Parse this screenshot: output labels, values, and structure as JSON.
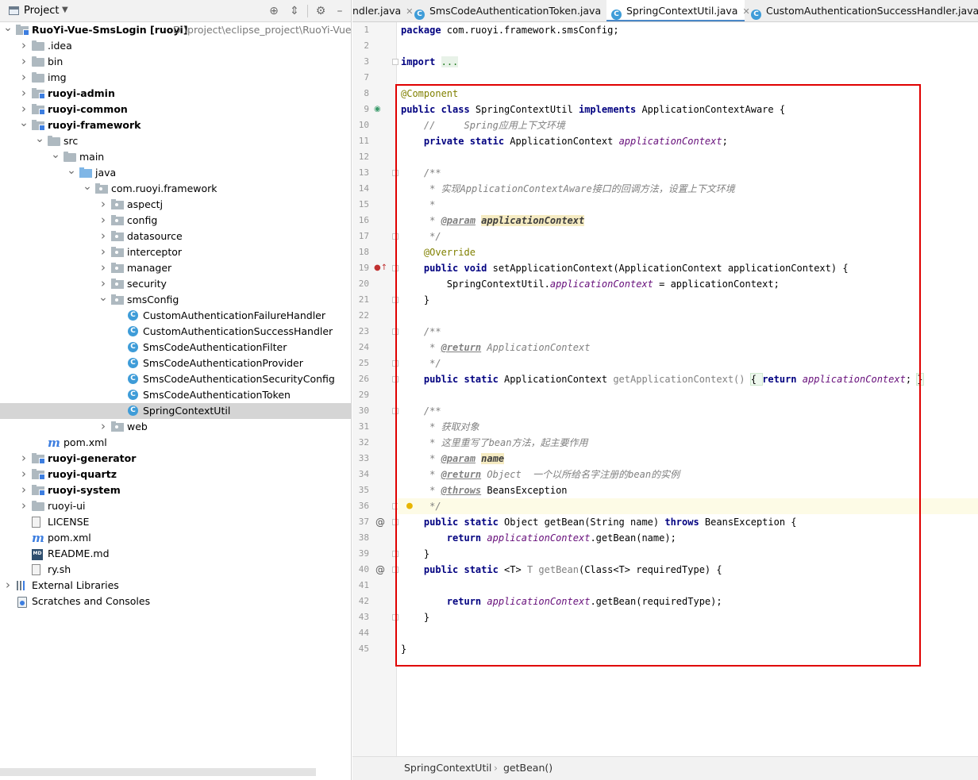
{
  "project": {
    "title": "Project",
    "tree": [
      {
        "label": "RuoYi-Vue-SmsLogin [ruoyi]",
        "path": "D:\\project\\eclipse_project\\RuoYi-Vue-Sms",
        "depth": 0,
        "arrow": "open",
        "icon": "module",
        "bold": true
      },
      {
        "label": ".idea",
        "depth": 1,
        "arrow": "closed",
        "icon": "folder"
      },
      {
        "label": "bin",
        "depth": 1,
        "arrow": "closed",
        "icon": "folder"
      },
      {
        "label": "img",
        "depth": 1,
        "arrow": "closed",
        "icon": "folder"
      },
      {
        "label": "ruoyi-admin",
        "depth": 1,
        "arrow": "closed",
        "icon": "module",
        "bold": true
      },
      {
        "label": "ruoyi-common",
        "depth": 1,
        "arrow": "closed",
        "icon": "module",
        "bold": true
      },
      {
        "label": "ruoyi-framework",
        "depth": 1,
        "arrow": "open",
        "icon": "module",
        "bold": true
      },
      {
        "label": "src",
        "depth": 2,
        "arrow": "open",
        "icon": "folder"
      },
      {
        "label": "main",
        "depth": 3,
        "arrow": "open",
        "icon": "folder"
      },
      {
        "label": "java",
        "depth": 4,
        "arrow": "open",
        "icon": "src"
      },
      {
        "label": "com.ruoyi.framework",
        "depth": 5,
        "arrow": "open",
        "icon": "pkg"
      },
      {
        "label": "aspectj",
        "depth": 6,
        "arrow": "closed",
        "icon": "pkg"
      },
      {
        "label": "config",
        "depth": 6,
        "arrow": "closed",
        "icon": "pkg"
      },
      {
        "label": "datasource",
        "depth": 6,
        "arrow": "closed",
        "icon": "pkg"
      },
      {
        "label": "interceptor",
        "depth": 6,
        "arrow": "closed",
        "icon": "pkg"
      },
      {
        "label": "manager",
        "depth": 6,
        "arrow": "closed",
        "icon": "pkg"
      },
      {
        "label": "security",
        "depth": 6,
        "arrow": "closed",
        "icon": "pkg"
      },
      {
        "label": "smsConfig",
        "depth": 6,
        "arrow": "open",
        "icon": "pkg"
      },
      {
        "label": "CustomAuthenticationFailureHandler",
        "depth": 7,
        "arrow": "none",
        "icon": "class"
      },
      {
        "label": "CustomAuthenticationSuccessHandler",
        "depth": 7,
        "arrow": "none",
        "icon": "class"
      },
      {
        "label": "SmsCodeAuthenticationFilter",
        "depth": 7,
        "arrow": "none",
        "icon": "class"
      },
      {
        "label": "SmsCodeAuthenticationProvider",
        "depth": 7,
        "arrow": "none",
        "icon": "class"
      },
      {
        "label": "SmsCodeAuthenticationSecurityConfig",
        "depth": 7,
        "arrow": "none",
        "icon": "class"
      },
      {
        "label": "SmsCodeAuthenticationToken",
        "depth": 7,
        "arrow": "none",
        "icon": "class"
      },
      {
        "label": "SpringContextUtil",
        "depth": 7,
        "arrow": "none",
        "icon": "class",
        "selected": true
      },
      {
        "label": "web",
        "depth": 6,
        "arrow": "closed",
        "icon": "pkg"
      },
      {
        "label": "pom.xml",
        "depth": 2,
        "arrow": "none",
        "icon": "maven"
      },
      {
        "label": "ruoyi-generator",
        "depth": 1,
        "arrow": "closed",
        "icon": "module",
        "bold": true
      },
      {
        "label": "ruoyi-quartz",
        "depth": 1,
        "arrow": "closed",
        "icon": "module",
        "bold": true
      },
      {
        "label": "ruoyi-system",
        "depth": 1,
        "arrow": "closed",
        "icon": "module",
        "bold": true
      },
      {
        "label": "ruoyi-ui",
        "depth": 1,
        "arrow": "closed",
        "icon": "folder"
      },
      {
        "label": "LICENSE",
        "depth": 1,
        "arrow": "none",
        "icon": "file"
      },
      {
        "label": "pom.xml",
        "depth": 1,
        "arrow": "none",
        "icon": "maven"
      },
      {
        "label": "README.md",
        "depth": 1,
        "arrow": "none",
        "icon": "md"
      },
      {
        "label": "ry.sh",
        "depth": 1,
        "arrow": "none",
        "icon": "file"
      },
      {
        "label": "External Libraries",
        "depth": 0,
        "arrow": "closed",
        "icon": "lib"
      },
      {
        "label": "Scratches and Consoles",
        "depth": 0,
        "arrow": "none",
        "icon": "scratch"
      }
    ]
  },
  "tabs": [
    {
      "label": "ndler.java",
      "icon": false,
      "active": false
    },
    {
      "label": "SmsCodeAuthenticationToken.java",
      "icon": true,
      "active": false
    },
    {
      "label": "SpringContextUtil.java",
      "icon": true,
      "active": true
    },
    {
      "label": "CustomAuthenticationSuccessHandler.java",
      "icon": true,
      "active": false
    }
  ],
  "icons": {
    "md_badge": "MD",
    "class_badge": "C"
  },
  "editor": {
    "lines": [
      {
        "n": "1",
        "tokens": [
          {
            "c": "kw",
            "t": "package"
          },
          {
            "c": "",
            "t": " com.ruoyi.framework.smsConfig;"
          }
        ]
      },
      {
        "n": "2",
        "tokens": []
      },
      {
        "n": "3",
        "tokens": [
          {
            "c": "kw",
            "t": "import"
          },
          {
            "c": "",
            "t": " "
          },
          {
            "c": "fold-dots",
            "t": "..."
          }
        ]
      },
      {
        "n": "7",
        "tokens": []
      },
      {
        "n": "8",
        "tokens": [
          {
            "c": "ann",
            "t": "@Component"
          }
        ]
      },
      {
        "n": "9",
        "tokens": [
          {
            "c": "kw",
            "t": "public class"
          },
          {
            "c": "",
            "t": " SpringContextUtil "
          },
          {
            "c": "kw",
            "t": "implements"
          },
          {
            "c": "",
            "t": " ApplicationContextAware {"
          }
        ]
      },
      {
        "n": "10",
        "tokens": [
          {
            "c": "",
            "t": "    "
          },
          {
            "c": "cmt",
            "t": "//     Spring应用上下文环境"
          }
        ]
      },
      {
        "n": "11",
        "tokens": [
          {
            "c": "",
            "t": "    "
          },
          {
            "c": "kw",
            "t": "private static"
          },
          {
            "c": "",
            "t": " ApplicationContext "
          },
          {
            "c": "field",
            "t": "applicationContext"
          },
          {
            "c": "",
            "t": ";"
          }
        ]
      },
      {
        "n": "12",
        "tokens": []
      },
      {
        "n": "13",
        "tokens": [
          {
            "c": "",
            "t": "    "
          },
          {
            "c": "cmt",
            "t": "/**"
          }
        ]
      },
      {
        "n": "14",
        "tokens": [
          {
            "c": "",
            "t": "     "
          },
          {
            "c": "cmt",
            "t": "* 实现ApplicationContextAware接口的回调方法，设置上下文环境"
          }
        ]
      },
      {
        "n": "15",
        "tokens": [
          {
            "c": "",
            "t": "     "
          },
          {
            "c": "cmt",
            "t": "*"
          }
        ]
      },
      {
        "n": "16",
        "tokens": [
          {
            "c": "",
            "t": "     "
          },
          {
            "c": "cmt",
            "t": "* "
          },
          {
            "c": "doctag",
            "t": "@param"
          },
          {
            "c": "",
            "t": " "
          },
          {
            "c": "paramhl hl",
            "t": "applicationContext"
          }
        ]
      },
      {
        "n": "17",
        "tokens": [
          {
            "c": "",
            "t": "     "
          },
          {
            "c": "cmt",
            "t": "*/"
          }
        ]
      },
      {
        "n": "18",
        "tokens": [
          {
            "c": "",
            "t": "    "
          },
          {
            "c": "ann",
            "t": "@Override"
          }
        ]
      },
      {
        "n": "19",
        "tokens": [
          {
            "c": "",
            "t": "    "
          },
          {
            "c": "kw",
            "t": "public void"
          },
          {
            "c": "",
            "t": " setApplicationContext(ApplicationContext applicationContext) {"
          }
        ]
      },
      {
        "n": "20",
        "tokens": [
          {
            "c": "",
            "t": "        SpringContextUtil."
          },
          {
            "c": "field",
            "t": "applicationContext"
          },
          {
            "c": "",
            "t": " = applicationContext;"
          }
        ]
      },
      {
        "n": "21",
        "tokens": [
          {
            "c": "",
            "t": "    }"
          }
        ]
      },
      {
        "n": "22",
        "tokens": []
      },
      {
        "n": "23",
        "tokens": [
          {
            "c": "",
            "t": "    "
          },
          {
            "c": "cmt",
            "t": "/**"
          }
        ]
      },
      {
        "n": "24",
        "tokens": [
          {
            "c": "",
            "t": "     "
          },
          {
            "c": "cmt",
            "t": "* "
          },
          {
            "c": "doctag",
            "t": "@return"
          },
          {
            "c": "cmt",
            "t": " ApplicationContext"
          }
        ]
      },
      {
        "n": "25",
        "tokens": [
          {
            "c": "",
            "t": "     "
          },
          {
            "c": "cmt",
            "t": "*/"
          }
        ]
      },
      {
        "n": "26",
        "tokens": [
          {
            "c": "",
            "t": "    "
          },
          {
            "c": "kw",
            "t": "public static"
          },
          {
            "c": "",
            "t": " ApplicationContext "
          },
          {
            "c": "grey",
            "t": "getApplicationContext()"
          },
          {
            "c": "",
            "t": " "
          },
          {
            "c": "greenbox",
            "t": "{ "
          },
          {
            "c": "kw",
            "t": "return"
          },
          {
            "c": "",
            "t": " "
          },
          {
            "c": "field",
            "t": "applicationContext"
          },
          {
            "c": "",
            "t": "; "
          },
          {
            "c": "greenbox",
            "t": "}"
          }
        ]
      },
      {
        "n": "29",
        "tokens": []
      },
      {
        "n": "30",
        "tokens": [
          {
            "c": "",
            "t": "    "
          },
          {
            "c": "cmt",
            "t": "/**"
          }
        ]
      },
      {
        "n": "31",
        "tokens": [
          {
            "c": "",
            "t": "     "
          },
          {
            "c": "cmt",
            "t": "* 获取对象"
          }
        ]
      },
      {
        "n": "32",
        "tokens": [
          {
            "c": "",
            "t": "     "
          },
          {
            "c": "cmt",
            "t": "* 这里重写了bean方法，起主要作用"
          }
        ]
      },
      {
        "n": "33",
        "tokens": [
          {
            "c": "",
            "t": "     "
          },
          {
            "c": "cmt",
            "t": "* "
          },
          {
            "c": "doctag",
            "t": "@param"
          },
          {
            "c": "",
            "t": " "
          },
          {
            "c": "paramhl hl",
            "t": "name"
          }
        ]
      },
      {
        "n": "34",
        "tokens": [
          {
            "c": "",
            "t": "     "
          },
          {
            "c": "cmt",
            "t": "* "
          },
          {
            "c": "doctag",
            "t": "@return"
          },
          {
            "c": "cmt",
            "t": " Object  一个以所给名字注册的bean的实例"
          }
        ]
      },
      {
        "n": "35",
        "tokens": [
          {
            "c": "",
            "t": "     "
          },
          {
            "c": "cmt",
            "t": "* "
          },
          {
            "c": "doctag",
            "t": "@throws"
          },
          {
            "c": "",
            "t": " BeansException"
          }
        ]
      },
      {
        "n": "36",
        "tokens": [
          {
            "c": "",
            "t": "     "
          },
          {
            "c": "cmt",
            "t": "*/"
          }
        ],
        "current": true
      },
      {
        "n": "37",
        "tokens": [
          {
            "c": "",
            "t": "    "
          },
          {
            "c": "kw",
            "t": "public static"
          },
          {
            "c": "",
            "t": " Object getBean(String name) "
          },
          {
            "c": "kw",
            "t": "throws"
          },
          {
            "c": "",
            "t": " BeansException {"
          }
        ]
      },
      {
        "n": "38",
        "tokens": [
          {
            "c": "",
            "t": "        "
          },
          {
            "c": "kw",
            "t": "return"
          },
          {
            "c": "",
            "t": " "
          },
          {
            "c": "field",
            "t": "applicationContext"
          },
          {
            "c": "",
            "t": ".getBean(name);"
          }
        ]
      },
      {
        "n": "39",
        "tokens": [
          {
            "c": "",
            "t": "    }"
          }
        ]
      },
      {
        "n": "40",
        "tokens": [
          {
            "c": "",
            "t": "    "
          },
          {
            "c": "kw",
            "t": "public static"
          },
          {
            "c": "",
            "t": " <T> "
          },
          {
            "c": "grey",
            "t": "T getBean"
          },
          {
            "c": "",
            "t": "(Class<T> requiredType) {"
          }
        ]
      },
      {
        "n": "41",
        "tokens": []
      },
      {
        "n": "42",
        "tokens": [
          {
            "c": "",
            "t": "        "
          },
          {
            "c": "kw",
            "t": "return"
          },
          {
            "c": "",
            "t": " "
          },
          {
            "c": "field",
            "t": "applicationContext"
          },
          {
            "c": "",
            "t": ".getBean(requiredType);"
          }
        ]
      },
      {
        "n": "43",
        "tokens": [
          {
            "c": "",
            "t": "    }"
          }
        ]
      },
      {
        "n": "44",
        "tokens": []
      },
      {
        "n": "45",
        "tokens": [
          {
            "c": "",
            "t": "}"
          }
        ]
      }
    ]
  },
  "breadcrumb": [
    "SpringContextUtil",
    "getBean()"
  ]
}
